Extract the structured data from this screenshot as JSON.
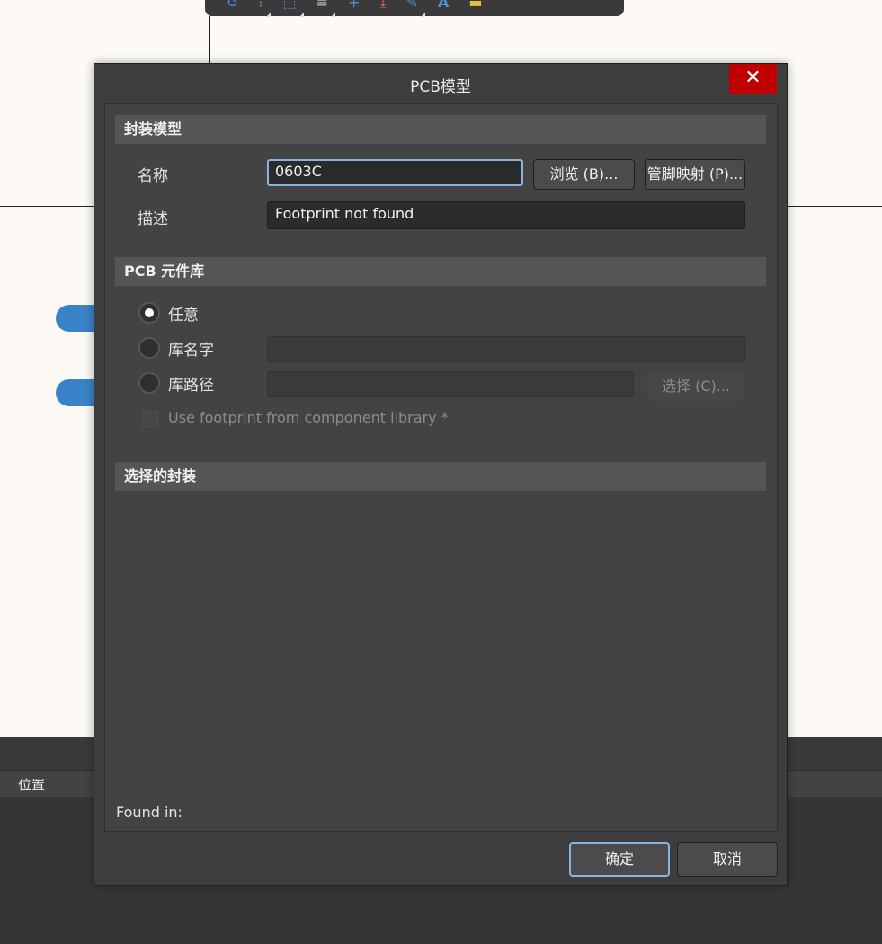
{
  "background": {
    "toolbar_icons": [
      "undo-icon",
      "move-icon",
      "select-area-icon",
      "align-icon",
      "cross-icon",
      "place-icon",
      "pencil-icon",
      "text-icon",
      "part-icon"
    ],
    "bottom_panel": {
      "column_label": "位置"
    }
  },
  "dialog": {
    "title": "PCB模型",
    "close_glyph": "✕",
    "footprint_model": {
      "header": "封装模型",
      "name_label": "名称",
      "name_value": "0603C",
      "browse_button": "浏览 (B)...",
      "pinmap_button": "管脚映射 (P)...",
      "description_label": "描述",
      "description_value": "Footprint not found"
    },
    "pcb_library": {
      "header": "PCB 元件库",
      "options": [
        "任意",
        "库名字",
        "库路径"
      ],
      "selected_option": "任意",
      "choose_button": "选择 (C)...",
      "use_footprint_checkbox": "Use footprint from component library *"
    },
    "selected_footprint": {
      "header": "选择的封装"
    },
    "found_in_label": "Found in:",
    "ok_button": "确定",
    "cancel_button": "取消"
  }
}
